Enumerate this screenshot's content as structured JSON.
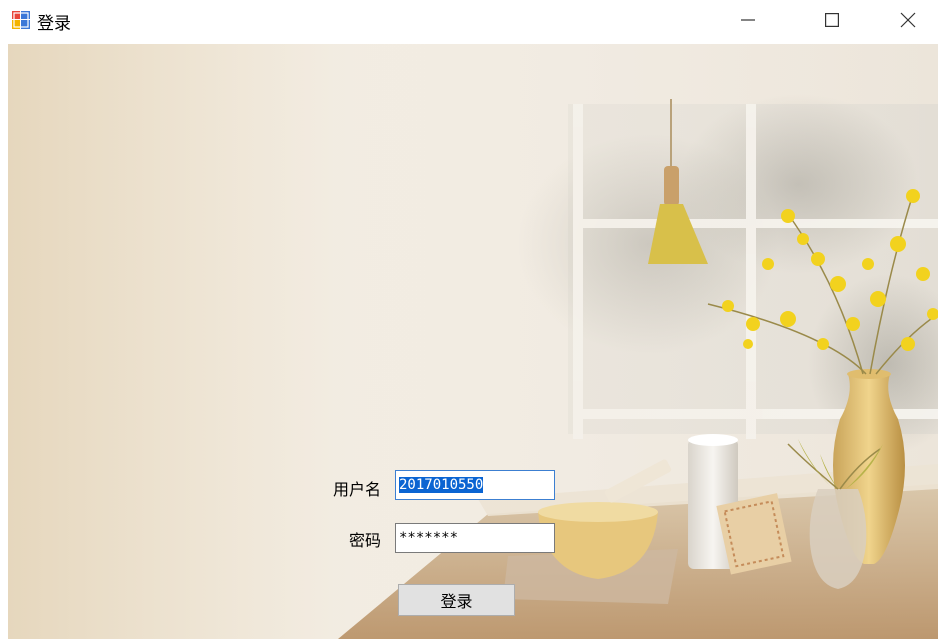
{
  "window": {
    "title": "登录",
    "icon": "app-window-icon",
    "controls": [
      "minimize-icon",
      "maximize-icon",
      "close-icon"
    ]
  },
  "form": {
    "username_label": "用户名",
    "username_value": "2017010550",
    "password_label": "密码",
    "password_value": "*******",
    "login_button": "登录"
  },
  "colors": {
    "selection": "#0a64d2",
    "focused_border": "#3c7fd1",
    "button_bg": "#e1e1e1"
  }
}
